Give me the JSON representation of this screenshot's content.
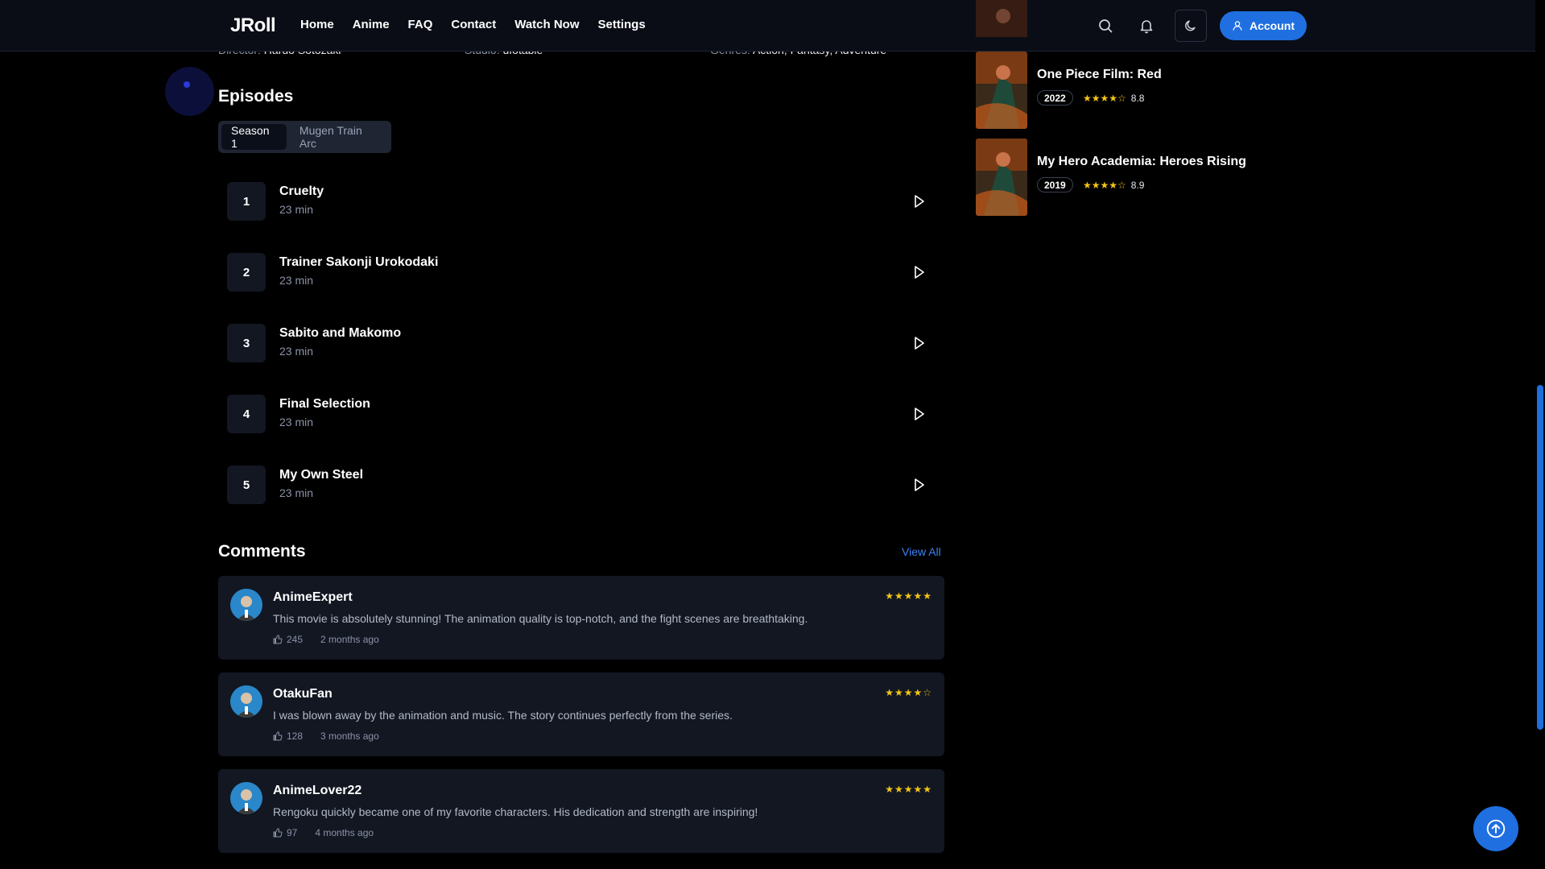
{
  "header": {
    "logo": "JRoll",
    "nav": [
      "Home",
      "Anime",
      "FAQ",
      "Contact",
      "Watch Now",
      "Settings"
    ],
    "account_label": "Account"
  },
  "details": {
    "director_label": "Director:",
    "director": "Haruo Sotozaki",
    "studio_label": "Studio:",
    "studio": "ufotable",
    "genres_label": "Genres:",
    "genres": "Action, Fantasy, Adventure"
  },
  "episodes": {
    "title": "Episodes",
    "tabs": [
      "Season 1",
      "Mugen Train Arc"
    ],
    "active_tab": "Season 1",
    "items": [
      {
        "num": "1",
        "title": "Cruelty",
        "duration": "23 min"
      },
      {
        "num": "2",
        "title": "Trainer Sakonji Urokodaki",
        "duration": "23 min"
      },
      {
        "num": "3",
        "title": "Sabito and Makomo",
        "duration": "23 min"
      },
      {
        "num": "4",
        "title": "Final Selection",
        "duration": "23 min"
      },
      {
        "num": "5",
        "title": "My Own Steel",
        "duration": "23 min"
      }
    ]
  },
  "comments": {
    "title": "Comments",
    "view_all": "View All",
    "items": [
      {
        "user": "AnimeExpert",
        "rating": 5,
        "text": "This movie is absolutely stunning! The animation quality is top-notch, and the fight scenes are breathtaking.",
        "likes": "245",
        "time": "2 months ago"
      },
      {
        "user": "OtakuFan",
        "rating": 4,
        "text": "I was blown away by the animation and music. The story continues perfectly from the series.",
        "likes": "128",
        "time": "3 months ago"
      },
      {
        "user": "AnimeLover22",
        "rating": 5,
        "text": "Rengoku quickly became one of my favorite characters. His dedication and strength are inspiring!",
        "likes": "97",
        "time": "4 months ago"
      }
    ]
  },
  "recommendations": [
    {
      "title": "One Piece Film: Red",
      "year": "2022",
      "rating": 4,
      "score": "8.8"
    },
    {
      "title": "My Hero Academia: Heroes Rising",
      "year": "2019",
      "rating": 4,
      "score": "8.9"
    }
  ],
  "colors": {
    "accent": "#1f6fe0",
    "star": "#f5c518",
    "background": "#000000",
    "card": "#121722"
  },
  "icons": {
    "search": "search-icon",
    "bell": "bell-icon",
    "theme": "moon-icon",
    "account": "user-icon",
    "play": "play-icon",
    "like": "thumbs-up-icon",
    "to_top": "arrow-up-circle-icon"
  }
}
